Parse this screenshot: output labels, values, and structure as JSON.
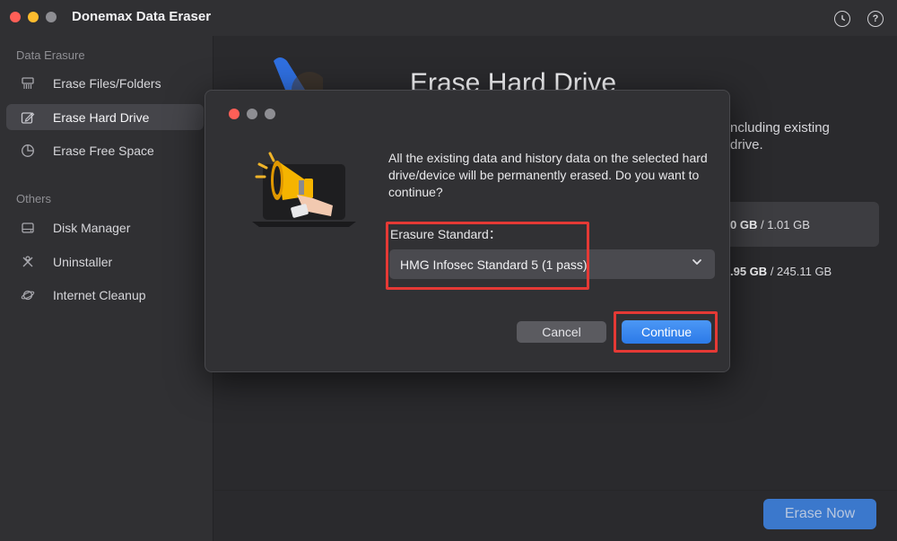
{
  "window": {
    "title": "Donemax Data Eraser",
    "history_icon": "clock-icon",
    "help_icon": "help-icon",
    "help_glyph": "?"
  },
  "sidebar": {
    "sections": [
      {
        "title": "Data Erasure",
        "items": [
          {
            "label": "Erase Files/Folders",
            "icon": "shredder-icon",
            "active": false
          },
          {
            "label": "Erase Hard Drive",
            "icon": "drive-edit-icon",
            "active": true
          },
          {
            "label": "Erase Free Space",
            "icon": "pie-icon",
            "active": false
          }
        ]
      },
      {
        "title": "Others",
        "items": [
          {
            "label": "Disk Manager",
            "icon": "disk-icon",
            "active": false
          },
          {
            "label": "Uninstaller",
            "icon": "tools-icon",
            "active": false
          },
          {
            "label": "Internet Cleanup",
            "icon": "planet-icon",
            "active": false
          }
        ]
      }
    ]
  },
  "main": {
    "title": "Erase Hard Drive",
    "description_line1": "ncluding existing",
    "description_line2": "drive.",
    "drives": [
      {
        "used": "0 GB",
        "total": "/ 1.01 GB",
        "selected": true
      },
      {
        "used": ".95 GB",
        "total": "/ 245.11 GB",
        "selected": false
      }
    ],
    "erase_now_label": "Erase Now"
  },
  "dialog": {
    "message": "All the existing data and history data on the selected hard drive/device will be permanently erased. Do you want to continue?",
    "standard_label": "Erasure Standard：",
    "standard_value": "HMG Infosec Standard 5 (1 pass)",
    "cancel_label": "Cancel",
    "continue_label": "Continue",
    "illustration": "megaphone-icon"
  },
  "colors": {
    "accent": "#3b8af0",
    "highlight": "#e53935",
    "close": "#ff5f57",
    "minimize": "#febc2e",
    "maximize": "#8e8e93"
  }
}
